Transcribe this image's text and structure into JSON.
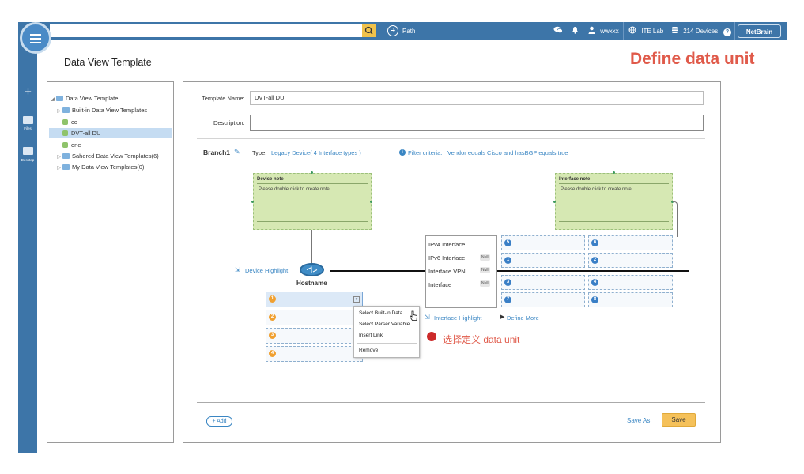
{
  "header": {
    "search_placeholder": "",
    "path_label": "Path",
    "user_label": "wwxxx",
    "lab_label": "ITE Lab",
    "devices_label": "214 Devices",
    "help_label": "?",
    "logo_text": "NetBrain",
    "accent": "#3d75a8"
  },
  "sidebar": {
    "add_label": "+",
    "items": [
      {
        "label": "Files",
        "icon": "folder-icon"
      },
      {
        "label": "Desktop",
        "icon": "monitor-icon"
      }
    ]
  },
  "page_title": "Data View Template",
  "annotation_title": "Define data unit",
  "tree": {
    "root": "Data View Template",
    "items": [
      {
        "label": "Built-in Data View Templates",
        "kind": "folder"
      },
      {
        "label": "cc",
        "kind": "template"
      },
      {
        "label": "DVT-all DU",
        "kind": "template",
        "selected": true
      },
      {
        "label": "one",
        "kind": "template"
      },
      {
        "label": "Sahered Data View Templates(6)",
        "kind": "folder"
      },
      {
        "label": "My Data View Templates(0)",
        "kind": "folder"
      }
    ]
  },
  "form": {
    "template_name_label": "Template Name:",
    "template_name_value": "DVT-all DU",
    "description_label": "Description:",
    "description_value": ""
  },
  "branch": {
    "name": "Branch1",
    "type_label": "Type:",
    "type_value": "Legacy Device( 4 Interface types )",
    "filter_icon_text": "i",
    "filter_label": "Filter criteria:",
    "filter_value": "Vendor equals Cisco and hasBGP equals true"
  },
  "device_note": {
    "title": "Device note",
    "body": "Please double click to create note."
  },
  "interface_note": {
    "title": "Interface note",
    "body": "Please double click to create note."
  },
  "device": {
    "highlight_label": "Device Highlight",
    "hostname_label": "Hostname",
    "slots": [
      "1",
      "2",
      "3",
      "4"
    ]
  },
  "interfaces": {
    "items": [
      {
        "label": "IPv4 Interface",
        "tag": ""
      },
      {
        "label": "IPv6 Interface",
        "tag": "Null"
      },
      {
        "label": "Interface  VPN",
        "tag": "Null"
      },
      {
        "label": "Interface",
        "tag": "Null"
      }
    ],
    "slots": [
      "5",
      "6",
      "1",
      "2",
      "3",
      "4",
      "7",
      "8"
    ],
    "highlight_label": "Interface Highlight",
    "define_more_label": "Define More"
  },
  "context_menu": {
    "items": [
      "Select Built-in Data",
      "Select Parser Variable",
      "Insert Link",
      "Remove"
    ]
  },
  "chinese_note": "选择定义 data unit",
  "footer": {
    "add_label": "+ Add",
    "save_as_label": "Save As",
    "save_label": "Save"
  }
}
